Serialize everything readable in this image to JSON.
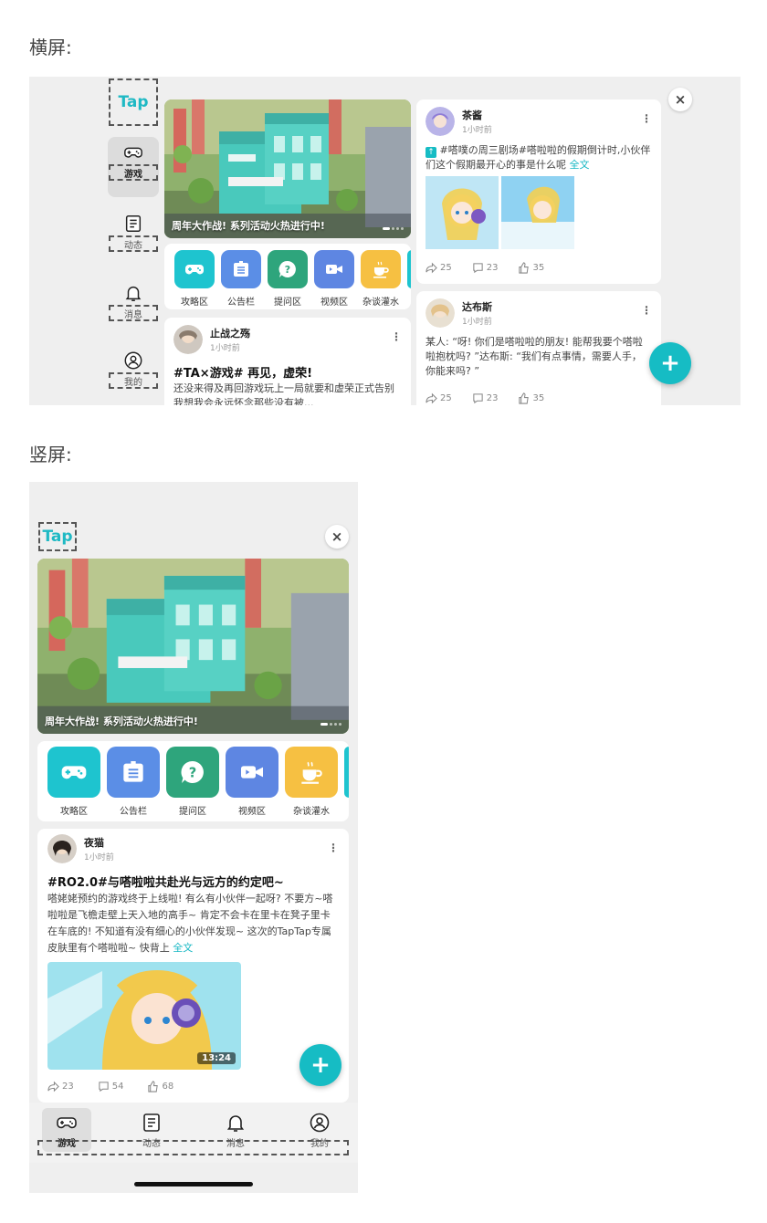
{
  "sections": {
    "landscape_title": "横屏:",
    "portrait_title": "竖屏:"
  },
  "brand": {
    "logo": "Tap",
    "accent": "#16bcc4"
  },
  "nav": [
    {
      "label": "游戏",
      "icon": "gamepad-icon",
      "active": true
    },
    {
      "label": "动态",
      "icon": "feed-icon",
      "active": false
    },
    {
      "label": "消息",
      "icon": "bell-icon",
      "active": false
    },
    {
      "label": "我的",
      "icon": "user-icon",
      "active": false
    }
  ],
  "banner": {
    "caption": "周年大作战! 系列活动火热进行中!"
  },
  "categories": [
    {
      "label": "攻略区",
      "icon": "gamepad-icon",
      "color": "#1ec4cf"
    },
    {
      "label": "公告栏",
      "icon": "notice-board-icon",
      "color": "#5b8ee6"
    },
    {
      "label": "提问区",
      "icon": "question-icon",
      "color": "#2ea57c"
    },
    {
      "label": "视频区",
      "icon": "video-camera-icon",
      "color": "#5e86e2"
    },
    {
      "label": "杂谈灌水",
      "icon": "coffee-cup-icon",
      "color": "#f6c042"
    }
  ],
  "landscape": {
    "post_left": {
      "user": "止战之殇",
      "time": "1小时前",
      "title": "#TA×游戏# 再见，虚荣!",
      "body": "还没来得及再回游戏玩上一局就要和虚荣正式告别我想我会永远怀念那些没有被..."
    },
    "post_right_1": {
      "user": "茶酱",
      "time": "1小时前",
      "body": "#嗒噗の周三剧场#嗒啦啦的假期倒计时,小伙伴们这个假期最开心的事是什么呢",
      "full": "全文",
      "shares": "25",
      "comments": "23",
      "likes": "35"
    },
    "post_right_2": {
      "user": "达布斯",
      "time": "1小时前",
      "body": "某人: “呀! 你们是嗒啦啦的朋友! 能帮我要个嗒啦啦抱枕吗? ”达布斯: “我们有点事情，需要人手，你能来吗? ”",
      "shares": "25",
      "comments": "23",
      "likes": "35"
    }
  },
  "portrait": {
    "post": {
      "user": "夜猫",
      "time": "1小时前",
      "title": "#RO2.0#与嗒啦啦共赴光与远方的约定吧~",
      "body": "嗒姥姥预约的游戏终于上线啦! 有么有小伙伴一起呀? 不要方~嗒啦啦是飞檐走壁上天入地的高手~ 肯定不会卡在里卡在凳子里卡在车底的! 不知道有没有细心的小伙伴发现~ 这次的TapTap专属皮肤里有个嗒啦啦~ 快背上",
      "full": "全文",
      "video_duration": "13:24",
      "shares": "23",
      "comments": "54",
      "likes": "68"
    }
  },
  "actions": {
    "close": "×",
    "fab": "+"
  }
}
